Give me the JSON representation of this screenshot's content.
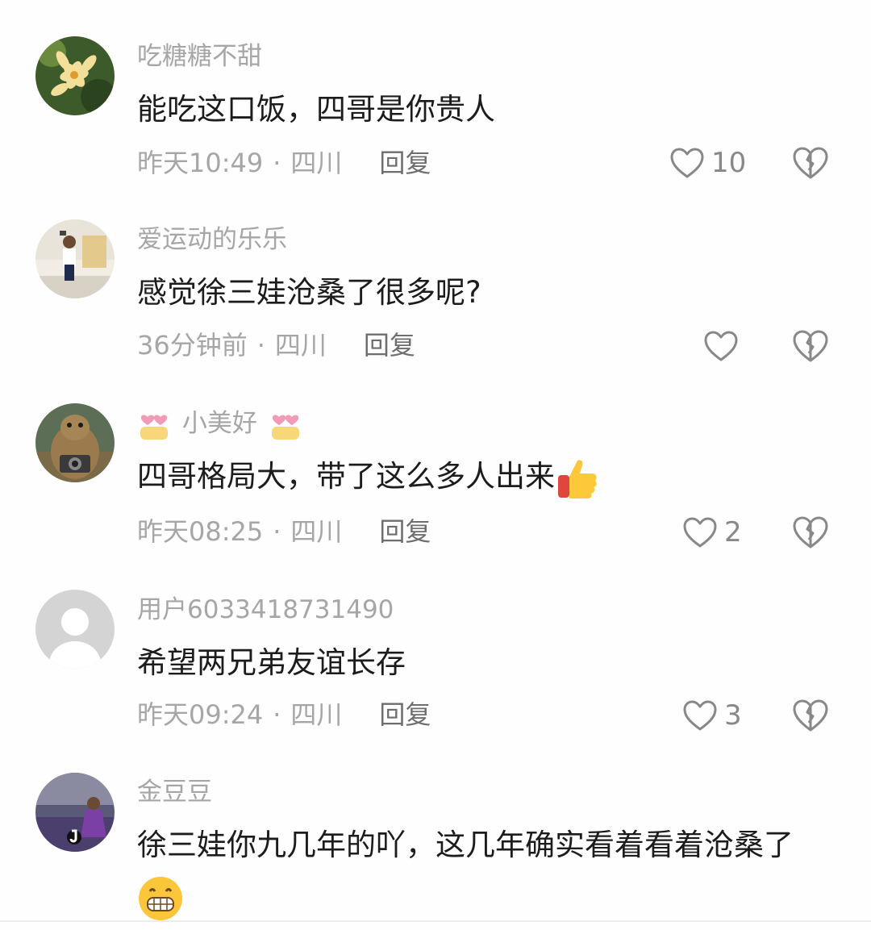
{
  "comments": [
    {
      "user": "吃糖糖不甜",
      "text": "能吃这口饭，四哥是你贵人",
      "time": "昨天10:49",
      "location": "四川",
      "reply": "回复",
      "likes": "10",
      "avatar": "yellow-flower-photo"
    },
    {
      "user": "爱运动的乐乐",
      "text": "感觉徐三娃沧桑了很多呢?",
      "time": "36分钟前",
      "location": "四川",
      "reply": "回复",
      "likes": "",
      "avatar": "child-photo"
    },
    {
      "user_prefix_emoji": "heart-hands-emoji",
      "user": "小美好",
      "user_suffix_emoji": "heart-hands-emoji",
      "text": "四哥格局大，带了这么多人出来",
      "text_emoji": "thumbs-up-emoji",
      "time": "昨天08:25",
      "location": "四川",
      "reply": "回复",
      "likes": "2",
      "avatar": "marmot-with-camera-photo"
    },
    {
      "user": "用户6033418731490",
      "text": "希望两兄弟友谊长存",
      "time": "昨天09:24",
      "location": "四川",
      "reply": "回复",
      "likes": "3",
      "avatar": "default-user-avatar"
    },
    {
      "user": "金豆豆",
      "text": "徐三娃你九几年的吖，这几年确实看着看着沧桑了",
      "text_emoji": "grinning-face-emoji",
      "avatar": "lavender-field-photo"
    }
  ],
  "separator": "·",
  "colors": {
    "background": "#fefefe",
    "username": "#a6a6a6",
    "body": "#1c1c1c",
    "meta": "#a6a6a6",
    "icon": "#888888"
  }
}
